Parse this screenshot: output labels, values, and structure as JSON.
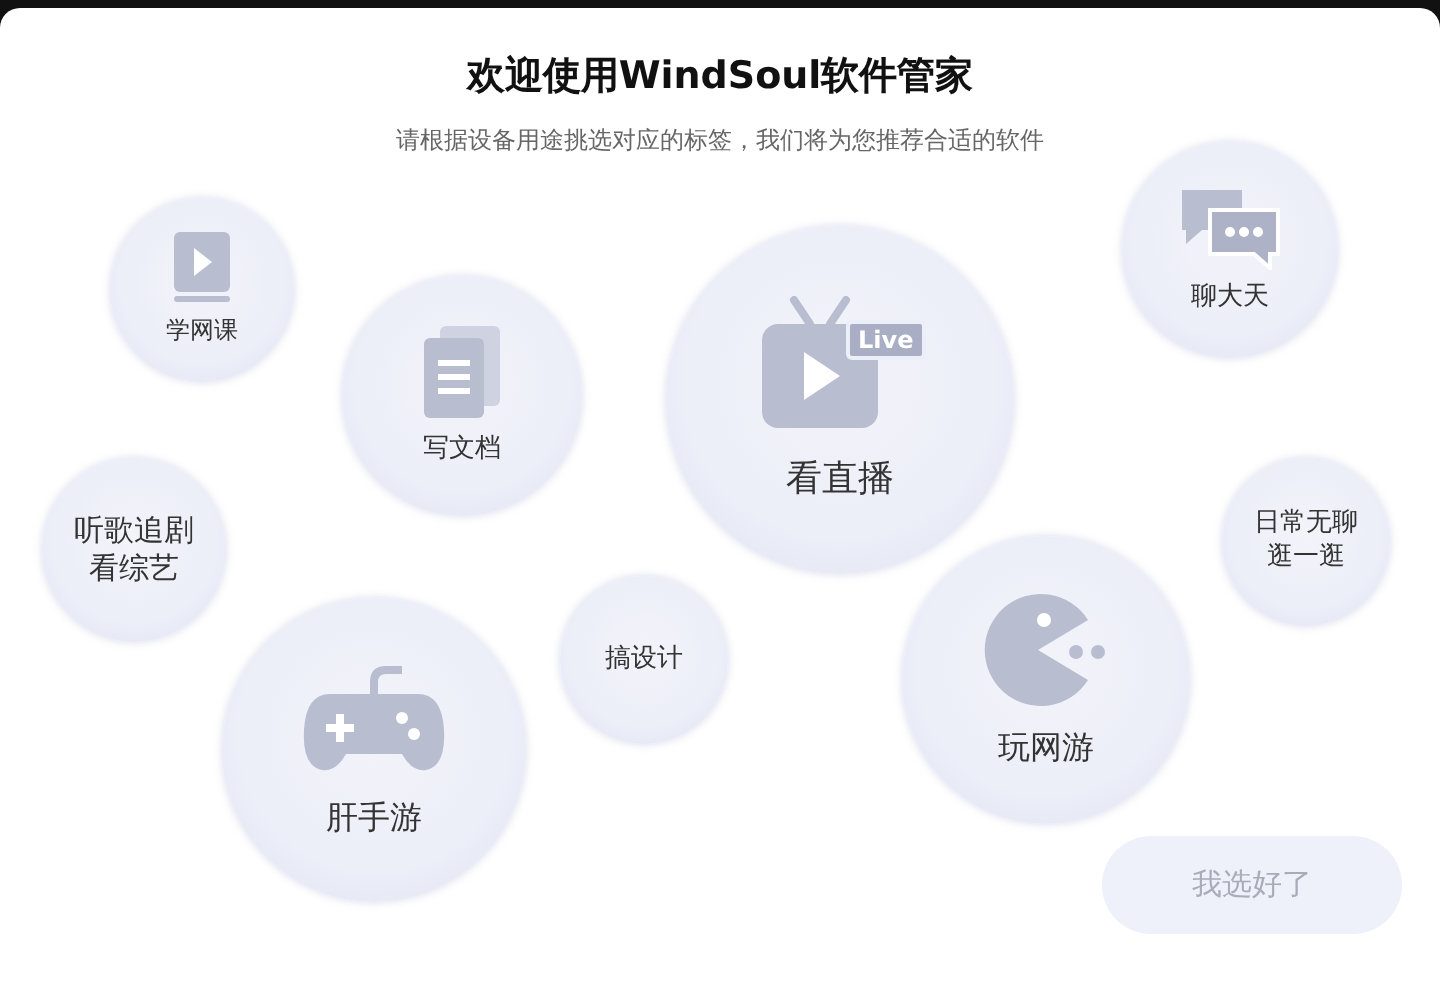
{
  "title": "欢迎使用WindSoul软件管家",
  "subtitle": "请根据设备用途挑选对应的标签，我们将为您推荐合适的软件",
  "tags": [
    {
      "kind": "book",
      "lines": [
        "学网课"
      ],
      "selected": false
    },
    {
      "kind": "document",
      "lines": [
        "写文档"
      ],
      "selected": false
    },
    {
      "kind": "live",
      "badge": "Live",
      "lines": [
        "看直播"
      ],
      "selected": false
    },
    {
      "kind": "chat",
      "lines": [
        "聊大天"
      ],
      "selected": false
    },
    {
      "kind": "text",
      "lines": [
        "听歌追剧",
        "看综艺"
      ],
      "selected": false
    },
    {
      "kind": "text",
      "lines": [
        "日常无聊",
        "逛一逛"
      ],
      "selected": false
    },
    {
      "kind": "text",
      "lines": [
        "搞设计"
      ],
      "selected": false
    },
    {
      "kind": "gamepad",
      "lines": [
        "肝手游"
      ],
      "selected": false
    },
    {
      "kind": "pacman",
      "lines": [
        "玩网游"
      ],
      "selected": false
    }
  ],
  "confirm_button": {
    "label": "我选好了",
    "disabled": true
  }
}
